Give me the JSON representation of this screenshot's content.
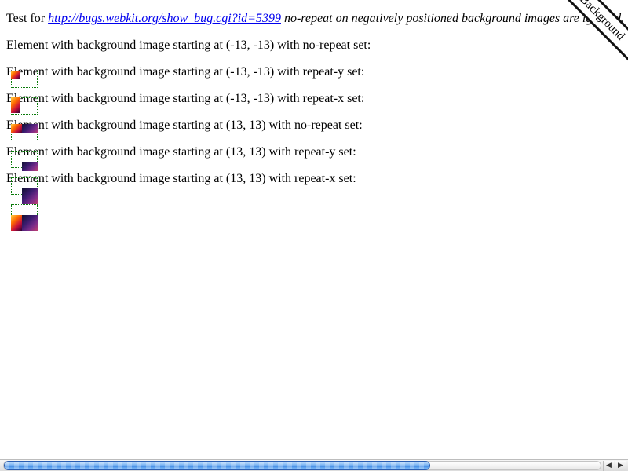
{
  "intro": {
    "prefix": "Test for ",
    "link_text": "http://bugs.webkit.org/show_bug.cgi?id=5399",
    "suffix": " no-repeat on negatively positioned background images are ignored."
  },
  "ribbon": {
    "text": "Background"
  },
  "tests": [
    {
      "label": "Element with background image starting at (-13, -13) with no-repeat set:"
    },
    {
      "label": "Element with background image starting at (-13, -13) with repeat-y set:"
    },
    {
      "label": "Element with background image starting at (-13, -13) with repeat-x set:"
    },
    {
      "label": "Element with background image starting at (13, 13) with no-repeat set:"
    },
    {
      "label": "Element with background image starting at (13, 13) with repeat-y set:"
    },
    {
      "label": "Element with background image starting at (13, 13) with repeat-x set:"
    }
  ],
  "scrollbar": {
    "left_arrow": "◀",
    "right_arrow": "▶"
  }
}
